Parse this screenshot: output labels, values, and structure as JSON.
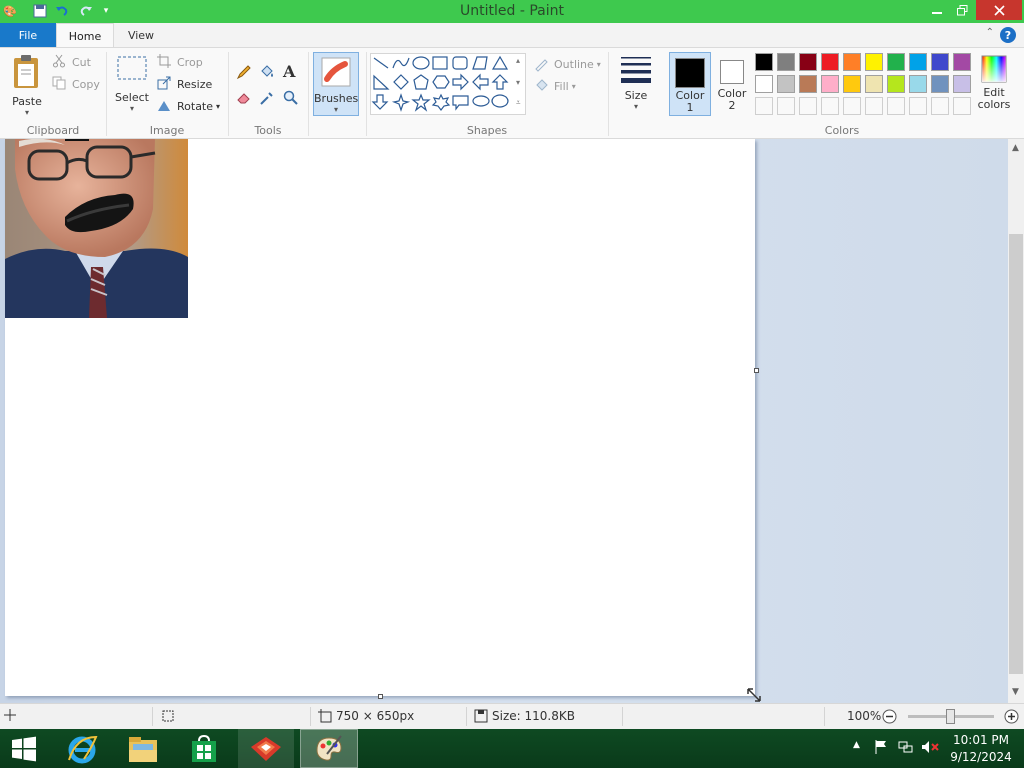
{
  "window": {
    "title": "Untitled - Paint"
  },
  "tabs": {
    "file": "File",
    "home": "Home",
    "view": "View"
  },
  "help": "?",
  "clipboard": {
    "paste": "Paste",
    "cut": "Cut",
    "copy": "Copy",
    "label": "Clipboard"
  },
  "image": {
    "select": "Select",
    "crop": "Crop",
    "resize": "Resize",
    "rotate": "Rotate",
    "label": "Image"
  },
  "tools": {
    "label": "Tools",
    "text_glyph": "A"
  },
  "brushes": {
    "label": "Brushes"
  },
  "shapes": {
    "outline": "Outline",
    "fill": "Fill",
    "label": "Shapes"
  },
  "size": {
    "label": "Size"
  },
  "color1": {
    "label": "Color 1"
  },
  "color2": {
    "label": "Color 2"
  },
  "colors": {
    "label": "Colors",
    "edit": "Edit colors",
    "row1": [
      "#000000",
      "#7f7f7f",
      "#880015",
      "#ed1c24",
      "#ff7f27",
      "#fff200",
      "#22b14c",
      "#00a2e8",
      "#3f48cc",
      "#a349a4"
    ],
    "row2": [
      "#ffffff",
      "#c3c3c3",
      "#b97a57",
      "#ffaec9",
      "#ffc90e",
      "#efe4b0",
      "#b5e61d",
      "#99d9ea",
      "#7092be",
      "#c8bfe7"
    ]
  },
  "status": {
    "dimensions": "750 × 650px",
    "size": "Size: 110.8KB",
    "zoom": "100%"
  },
  "tray": {
    "time": "10:01 PM",
    "date": "9/12/2024"
  },
  "accent": "#3ec94e"
}
